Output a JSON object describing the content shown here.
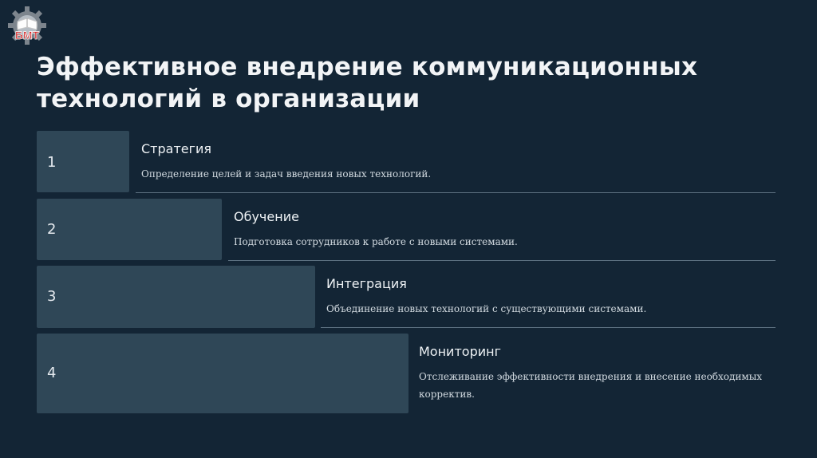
{
  "slide": {
    "title": "Эффективное внедрение коммуникационных технологий в организации",
    "logo_text": "БМТ"
  },
  "steps": [
    {
      "number": "1",
      "title": "Стратегия",
      "description": "Определение целей и задач введения новых технологий."
    },
    {
      "number": "2",
      "title": "Обучение",
      "description": "Подготовка сотрудников к работе с новыми системами."
    },
    {
      "number": "3",
      "title": "Интеграция",
      "description": "Объединение новых технологий с существующими системами."
    },
    {
      "number": "4",
      "title": "Мониторинг",
      "description": "Отслеживание эффективности внедрения и внесение необходимых корректив."
    }
  ]
}
